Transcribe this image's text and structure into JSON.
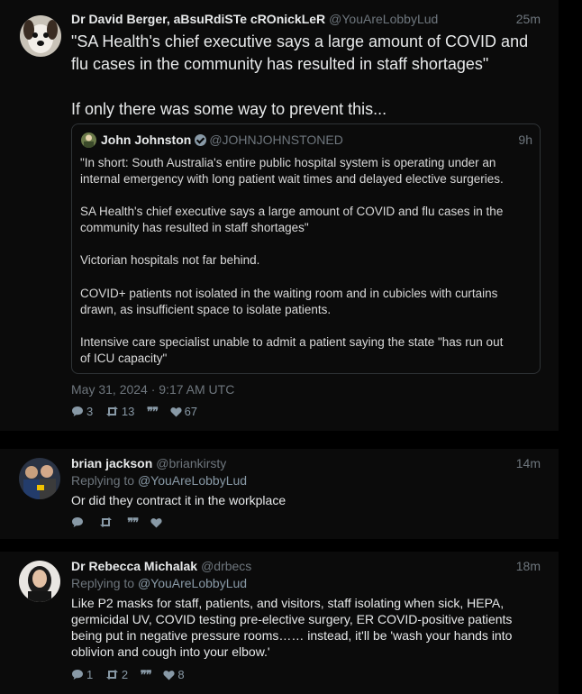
{
  "main_tweet": {
    "name": "Dr David Berger, aBsuRdiSTe cROnickLeR",
    "handle": "@YouAreLobbyLud",
    "time": "25m",
    "text_line1": "\"SA Health's chief executive says a large amount of COVID and",
    "text_line2": "flu cases in the community has resulted in staff shortages\"",
    "text_line3": "If only there was some way to prevent this...",
    "date": "May 31, 2024 · 9:17 AM UTC",
    "replies": "3",
    "retweets": "13",
    "likes": "67"
  },
  "quote": {
    "name": "John Johnston",
    "handle": "@JOHNJOHNSTONED",
    "time": "9h",
    "p1_l1": "\"In short: South Australia's entire public hospital system is operating under an",
    "p1_l2": "internal emergency with long patient wait times and delayed elective surgeries.",
    "p2_l1": "SA Health's chief executive says a large amount of COVID and flu cases in the",
    "p2_l2": "community has resulted in staff shortages\"",
    "p3": "Victorian hospitals not far behind.",
    "p4_l1": "COVID+ patients not isolated in the waiting room and  in cubicles with curtains",
    "p4_l2": "drawn, as insufficient space to isolate patients.",
    "p5_l1": "Intensive care specialist unable to admit a patient saying the state \"has run out",
    "p5_l2": "of ICU capacity\""
  },
  "reply1": {
    "name": "brian jackson",
    "handle": "@briankirsty",
    "time": "14m",
    "replying_prefix": "Replying to ",
    "replying_to": "@YouAreLobbyLud",
    "text": "Or did they contract it in the workplace",
    "replies": "",
    "retweets": "",
    "likes": ""
  },
  "reply2": {
    "name": "Dr Rebecca Michalak",
    "handle": "@drbecs",
    "time": "18m",
    "replying_prefix": "Replying to ",
    "replying_to": "@YouAreLobbyLud",
    "l1": "Like P2 masks for staff, patients, and visitors, staff isolating when sick, HEPA,",
    "l2": "germicidal UV, COVID testing pre-elective surgery, ER COVID-positive patients",
    "l3": "being put in negative pressure rooms…… instead, it'll be 'wash your hands into",
    "l4": "oblivion and cough into your elbow.'",
    "replies": "1",
    "retweets": "2",
    "likes": "8"
  },
  "icons": {
    "reply": "reply-icon",
    "retweet": "retweet-icon",
    "quote": "quote-icon",
    "like": "heart-icon",
    "verified": "verified-badge-icon"
  },
  "colors": {
    "background": "#000000",
    "card": "#0b0b0b",
    "text": "#e7e9ea",
    "muted": "#6e767d",
    "icon": "#8899a6"
  }
}
